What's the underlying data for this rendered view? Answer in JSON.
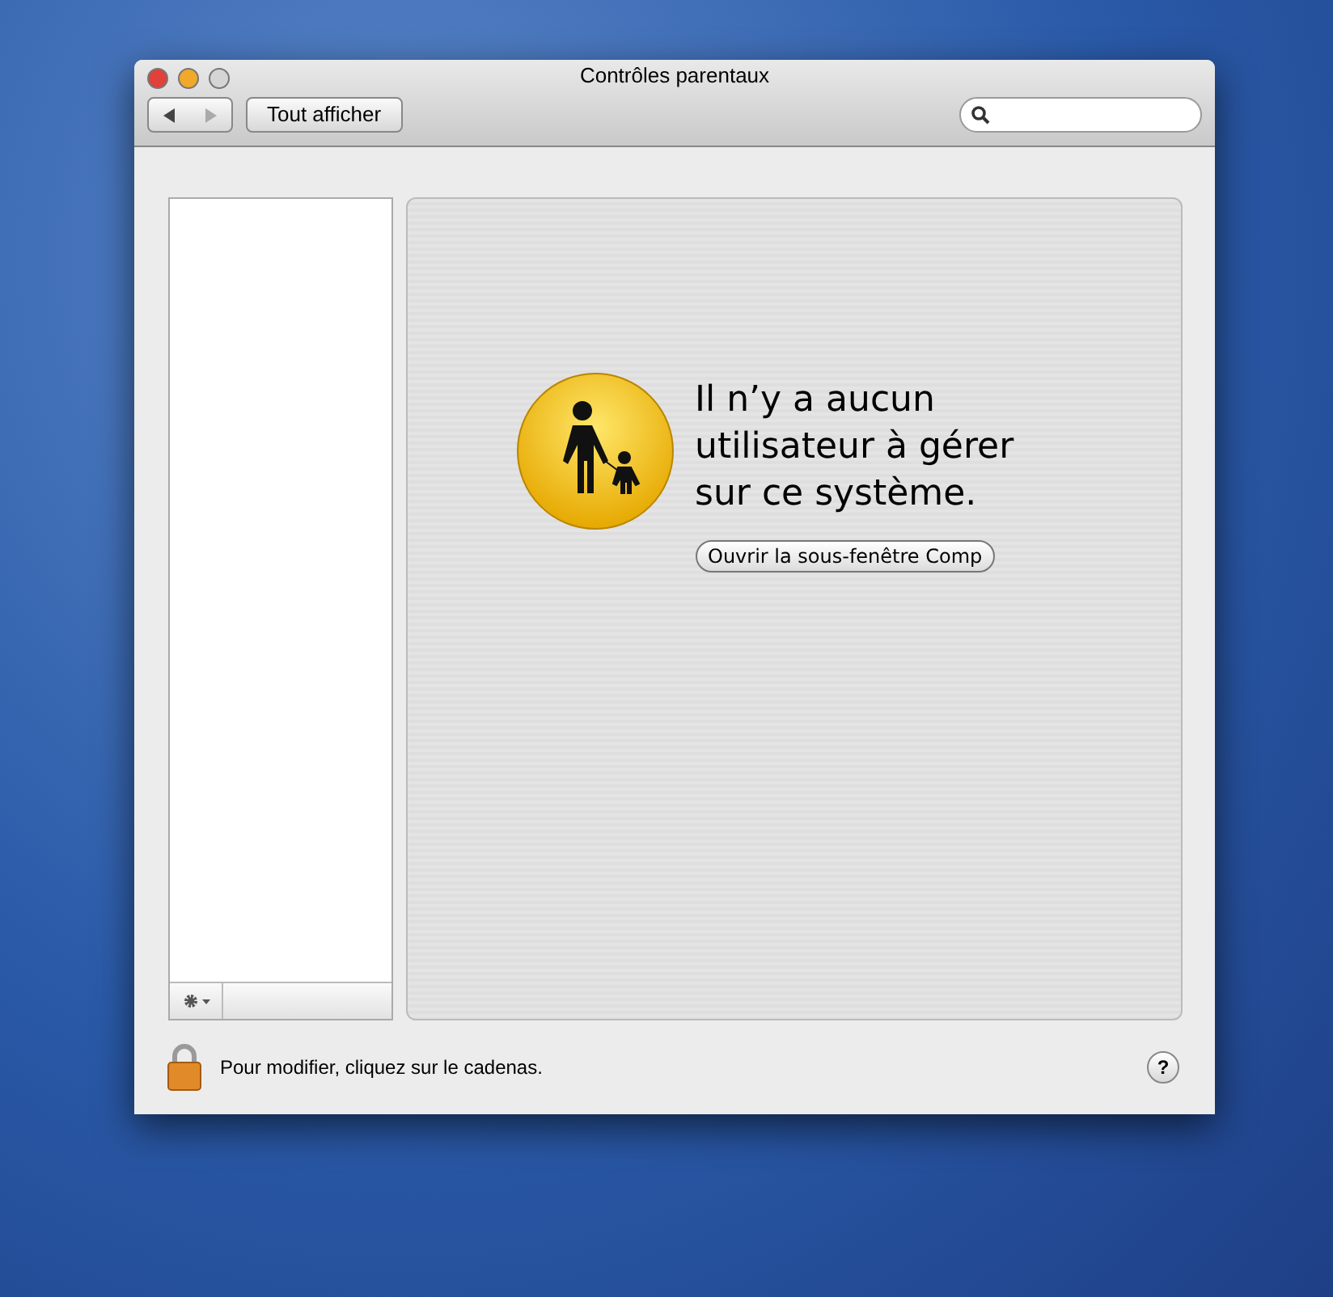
{
  "window": {
    "title": "Contrôles parentaux"
  },
  "toolbar": {
    "show_all_button": "Tout afficher"
  },
  "message": {
    "text": "Il n’y a aucun utilisateur à gérer sur ce système.",
    "button": "Ouvrir la sous-fenêtre Comp"
  },
  "footer": {
    "lock_text": "Pour modifier, cliquez sur le cadenas.",
    "help_button": "?"
  }
}
